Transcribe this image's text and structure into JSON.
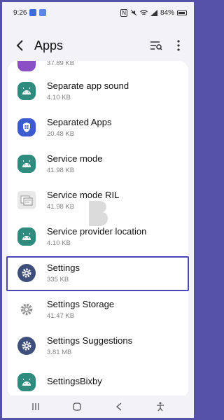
{
  "status": {
    "time": "9:26",
    "battery": "84%"
  },
  "header": {
    "title": "Apps"
  },
  "list": {
    "partial_size": "37.89 KB",
    "items": [
      {
        "name": "Separate app sound",
        "size": "4.10 KB",
        "icon": "android-icon"
      },
      {
        "name": "Separated Apps",
        "size": "20.48 KB",
        "icon": "shield-icon"
      },
      {
        "name": "Service mode",
        "size": "41.98 KB",
        "icon": "android-icon"
      },
      {
        "name": "Service mode RIL",
        "size": "41.98 KB",
        "icon": "service-mode-ril-icon"
      },
      {
        "name": "Service provider location",
        "size": "4.10 KB",
        "icon": "android-icon"
      },
      {
        "name": "Settings",
        "size": "335 KB",
        "icon": "gear-icon"
      },
      {
        "name": "Settings Storage",
        "size": "41.47 KB",
        "icon": "gear-icon"
      },
      {
        "name": "Settings Suggestions",
        "size": "3.81 MB",
        "icon": "gear-icon"
      },
      {
        "name": "SettingsBixby",
        "size": "",
        "icon": "android-icon"
      }
    ]
  },
  "colors": {
    "frame": "#5552a8",
    "highlight": "#4a46b5",
    "android_bg": "#2e8b7e",
    "shield_bg": "#3c5bd1",
    "gear_bg": "#3d4f7a"
  }
}
